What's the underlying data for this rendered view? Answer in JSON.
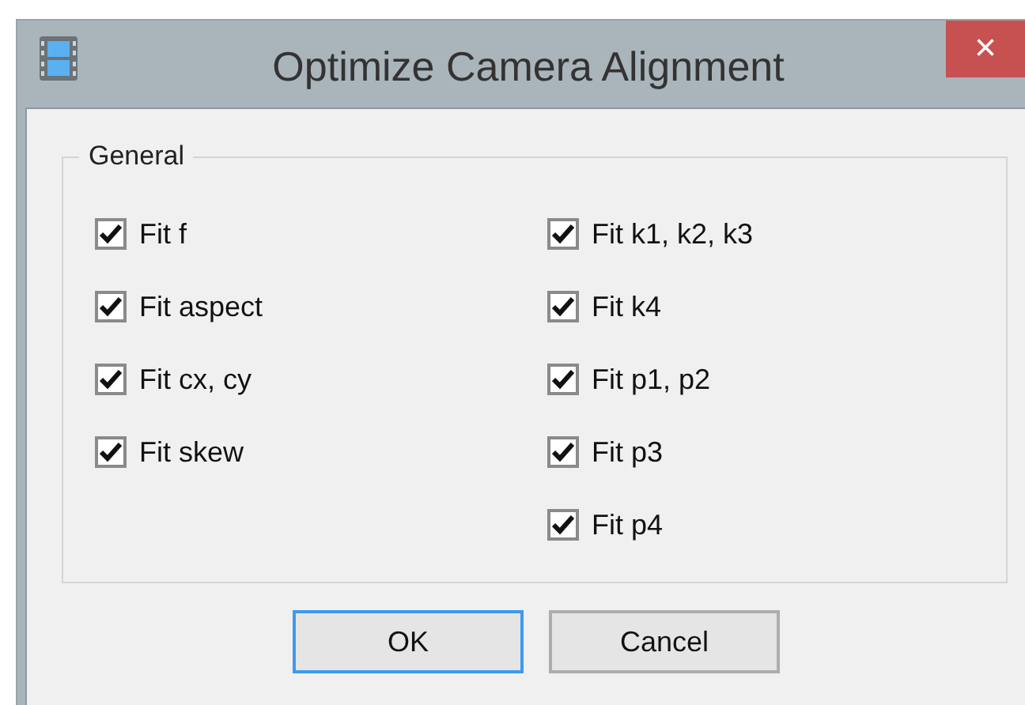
{
  "window": {
    "title": "Optimize Camera Alignment",
    "close": "×"
  },
  "group": {
    "title": "General",
    "columns": [
      [
        {
          "label": "Fit f",
          "checked": true
        },
        {
          "label": "Fit aspect",
          "checked": true
        },
        {
          "label": "Fit cx, cy",
          "checked": true
        },
        {
          "label": "Fit skew",
          "checked": true
        }
      ],
      [
        {
          "label": "Fit k1, k2, k3",
          "checked": true
        },
        {
          "label": "Fit k4",
          "checked": true
        },
        {
          "label": "Fit p1, p2",
          "checked": true
        },
        {
          "label": "Fit p3",
          "checked": true
        },
        {
          "label": "Fit p4",
          "checked": true
        }
      ]
    ]
  },
  "buttons": [
    {
      "label": "OK",
      "selected": true
    },
    {
      "label": "Cancel",
      "selected": false
    }
  ]
}
